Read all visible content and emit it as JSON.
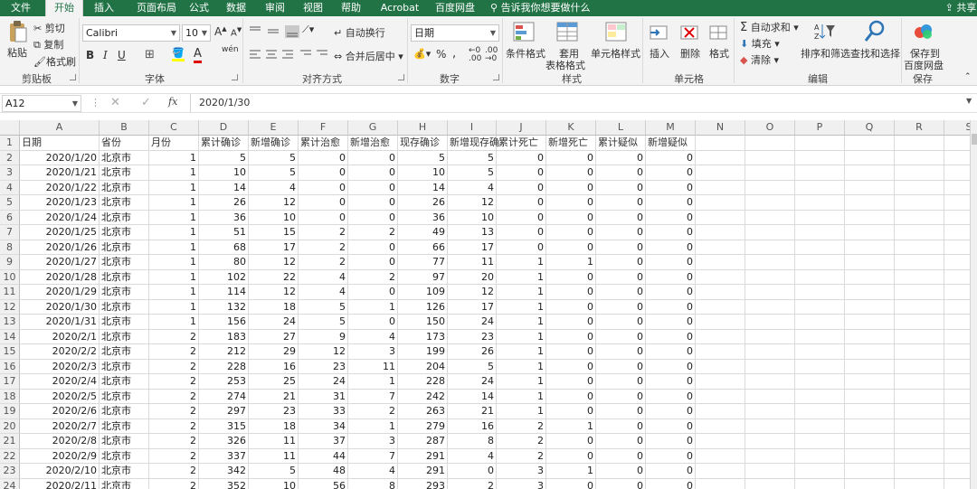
{
  "tabs": {
    "file": "文件",
    "home": "开始",
    "insert": "插入",
    "page_layout": "页面布局",
    "formulas": "公式",
    "data": "数据",
    "review": "审阅",
    "view": "视图",
    "help": "帮助",
    "acrobat": "Acrobat",
    "baidu": "百度网盘",
    "tell_me": "告诉我你想要做什么",
    "share": "共享"
  },
  "ribbon": {
    "clipboard": {
      "paste": "粘贴",
      "cut": "剪切",
      "copy": "复制",
      "format_painter": "格式刷",
      "group": "剪贴板"
    },
    "font": {
      "name": "Calibri",
      "size": "10",
      "bold": "B",
      "italic": "I",
      "underline": "U",
      "wen": "wén",
      "group": "字体"
    },
    "alignment": {
      "wrap": "自动换行",
      "merge": "合并后居中",
      "group": "对齐方式"
    },
    "number": {
      "format": "日期",
      "percent": "%",
      "comma": ",",
      "group": "数字"
    },
    "styles": {
      "conditional": "条件格式",
      "table_format_1": "套用",
      "table_format_2": "表格格式",
      "cell_styles": "单元格样式",
      "group": "样式"
    },
    "cells": {
      "insert": "插入",
      "delete": "删除",
      "format": "格式",
      "group": "单元格"
    },
    "editing": {
      "autosum": "自动求和",
      "fill": "填充",
      "clear": "清除",
      "sort": "排序和筛选",
      "find": "查找和选择",
      "group": "编辑"
    },
    "save": {
      "line1": "保存到",
      "line2": "百度网盘",
      "group": "保存"
    }
  },
  "formula_bar": {
    "name_box": "A12",
    "fx": "fx",
    "content": "2020/1/30"
  },
  "columns": [
    "A",
    "B",
    "C",
    "D",
    "E",
    "F",
    "G",
    "H",
    "I",
    "J",
    "K",
    "L",
    "M",
    "N",
    "O",
    "P",
    "Q",
    "R",
    "S"
  ],
  "headers": [
    "日期",
    "省份",
    "月份",
    "累计确诊",
    "新增确诊",
    "累计治愈",
    "新增治愈",
    "现存确诊",
    "新增现存确",
    "累计死亡",
    "新增死亡",
    "累计疑似",
    "新增疑似"
  ],
  "rows": [
    [
      "2020/1/20",
      "北京市",
      "1",
      "5",
      "5",
      "0",
      "0",
      "5",
      "5",
      "0",
      "0",
      "0",
      "0"
    ],
    [
      "2020/1/21",
      "北京市",
      "1",
      "10",
      "5",
      "0",
      "0",
      "10",
      "5",
      "0",
      "0",
      "0",
      "0"
    ],
    [
      "2020/1/22",
      "北京市",
      "1",
      "14",
      "4",
      "0",
      "0",
      "14",
      "4",
      "0",
      "0",
      "0",
      "0"
    ],
    [
      "2020/1/23",
      "北京市",
      "1",
      "26",
      "12",
      "0",
      "0",
      "26",
      "12",
      "0",
      "0",
      "0",
      "0"
    ],
    [
      "2020/1/24",
      "北京市",
      "1",
      "36",
      "10",
      "0",
      "0",
      "36",
      "10",
      "0",
      "0",
      "0",
      "0"
    ],
    [
      "2020/1/25",
      "北京市",
      "1",
      "51",
      "15",
      "2",
      "2",
      "49",
      "13",
      "0",
      "0",
      "0",
      "0"
    ],
    [
      "2020/1/26",
      "北京市",
      "1",
      "68",
      "17",
      "2",
      "0",
      "66",
      "17",
      "0",
      "0",
      "0",
      "0"
    ],
    [
      "2020/1/27",
      "北京市",
      "1",
      "80",
      "12",
      "2",
      "0",
      "77",
      "11",
      "1",
      "1",
      "0",
      "0"
    ],
    [
      "2020/1/28",
      "北京市",
      "1",
      "102",
      "22",
      "4",
      "2",
      "97",
      "20",
      "1",
      "0",
      "0",
      "0"
    ],
    [
      "2020/1/29",
      "北京市",
      "1",
      "114",
      "12",
      "4",
      "0",
      "109",
      "12",
      "1",
      "0",
      "0",
      "0"
    ],
    [
      "2020/1/30",
      "北京市",
      "1",
      "132",
      "18",
      "5",
      "1",
      "126",
      "17",
      "1",
      "0",
      "0",
      "0"
    ],
    [
      "2020/1/31",
      "北京市",
      "1",
      "156",
      "24",
      "5",
      "0",
      "150",
      "24",
      "1",
      "0",
      "0",
      "0"
    ],
    [
      "2020/2/1",
      "北京市",
      "2",
      "183",
      "27",
      "9",
      "4",
      "173",
      "23",
      "1",
      "0",
      "0",
      "0"
    ],
    [
      "2020/2/2",
      "北京市",
      "2",
      "212",
      "29",
      "12",
      "3",
      "199",
      "26",
      "1",
      "0",
      "0",
      "0"
    ],
    [
      "2020/2/3",
      "北京市",
      "2",
      "228",
      "16",
      "23",
      "11",
      "204",
      "5",
      "1",
      "0",
      "0",
      "0"
    ],
    [
      "2020/2/4",
      "北京市",
      "2",
      "253",
      "25",
      "24",
      "1",
      "228",
      "24",
      "1",
      "0",
      "0",
      "0"
    ],
    [
      "2020/2/5",
      "北京市",
      "2",
      "274",
      "21",
      "31",
      "7",
      "242",
      "14",
      "1",
      "0",
      "0",
      "0"
    ],
    [
      "2020/2/6",
      "北京市",
      "2",
      "297",
      "23",
      "33",
      "2",
      "263",
      "21",
      "1",
      "0",
      "0",
      "0"
    ],
    [
      "2020/2/7",
      "北京市",
      "2",
      "315",
      "18",
      "34",
      "1",
      "279",
      "16",
      "2",
      "1",
      "0",
      "0"
    ],
    [
      "2020/2/8",
      "北京市",
      "2",
      "326",
      "11",
      "37",
      "3",
      "287",
      "8",
      "2",
      "0",
      "0",
      "0"
    ],
    [
      "2020/2/9",
      "北京市",
      "2",
      "337",
      "11",
      "44",
      "7",
      "291",
      "4",
      "2",
      "0",
      "0",
      "0"
    ],
    [
      "2020/2/10",
      "北京市",
      "2",
      "342",
      "5",
      "48",
      "4",
      "291",
      "0",
      "3",
      "1",
      "0",
      "0"
    ],
    [
      "2020/2/11",
      "北京市",
      "2",
      "352",
      "10",
      "56",
      "8",
      "293",
      "2",
      "3",
      "0",
      "0",
      "0"
    ]
  ]
}
